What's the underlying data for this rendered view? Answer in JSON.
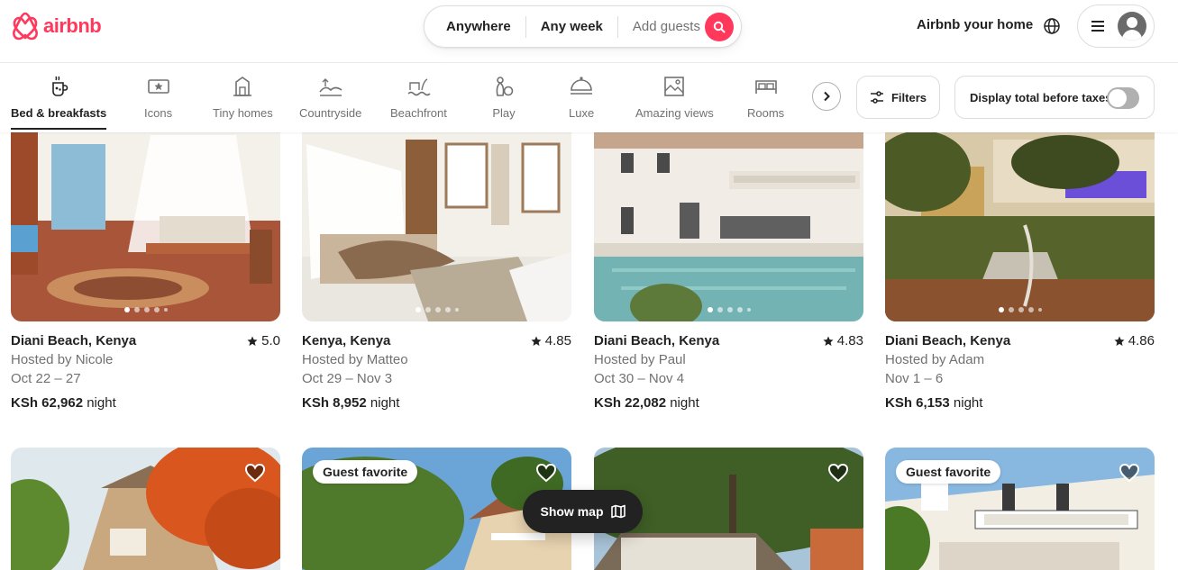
{
  "brand": {
    "name": "airbnb",
    "color": "#ff385c"
  },
  "search": {
    "where": "Anywhere",
    "when": "Any week",
    "who": "Add guests"
  },
  "header": {
    "host_link": "Airbnb your home"
  },
  "categories": [
    {
      "label": "Bed & breakfasts",
      "icon": "breakfast-icon",
      "active": true
    },
    {
      "label": "Icons",
      "icon": "icons-icon"
    },
    {
      "label": "Tiny homes",
      "icon": "tiny-home-icon"
    },
    {
      "label": "Countryside",
      "icon": "countryside-icon"
    },
    {
      "label": "Beachfront",
      "icon": "beachfront-icon"
    },
    {
      "label": "Play",
      "icon": "play-icon"
    },
    {
      "label": "Luxe",
      "icon": "luxe-icon"
    },
    {
      "label": "Amazing views",
      "icon": "amazing-views-icon"
    },
    {
      "label": "Rooms",
      "icon": "rooms-icon"
    }
  ],
  "filters": {
    "label": "Filters",
    "taxes_label": "Display total before taxes"
  },
  "listings": [
    {
      "location": "Diani Beach, Kenya",
      "rating": "5.0",
      "host": "Hosted by Nicole",
      "dates": "Oct 22 – 27",
      "price": "KSh 62,962",
      "unit": "night"
    },
    {
      "location": "Kenya, Kenya",
      "rating": "4.85",
      "host": "Hosted by Matteo",
      "dates": "Oct 29 – Nov 3",
      "price": "KSh 8,952",
      "unit": "night"
    },
    {
      "location": "Diani Beach, Kenya",
      "rating": "4.83",
      "host": "Hosted by Paul",
      "dates": "Oct 30 – Nov 4",
      "price": "KSh 22,082",
      "unit": "night"
    },
    {
      "location": "Diani Beach, Kenya",
      "rating": "4.86",
      "host": "Hosted by Adam",
      "dates": "Nov 1 – 6",
      "price": "KSh 6,153",
      "unit": "night"
    }
  ],
  "row2": [
    {
      "badge": ""
    },
    {
      "badge": "Guest favorite"
    },
    {
      "badge": ""
    },
    {
      "badge": "Guest favorite"
    }
  ],
  "show_map": {
    "label": "Show map"
  }
}
